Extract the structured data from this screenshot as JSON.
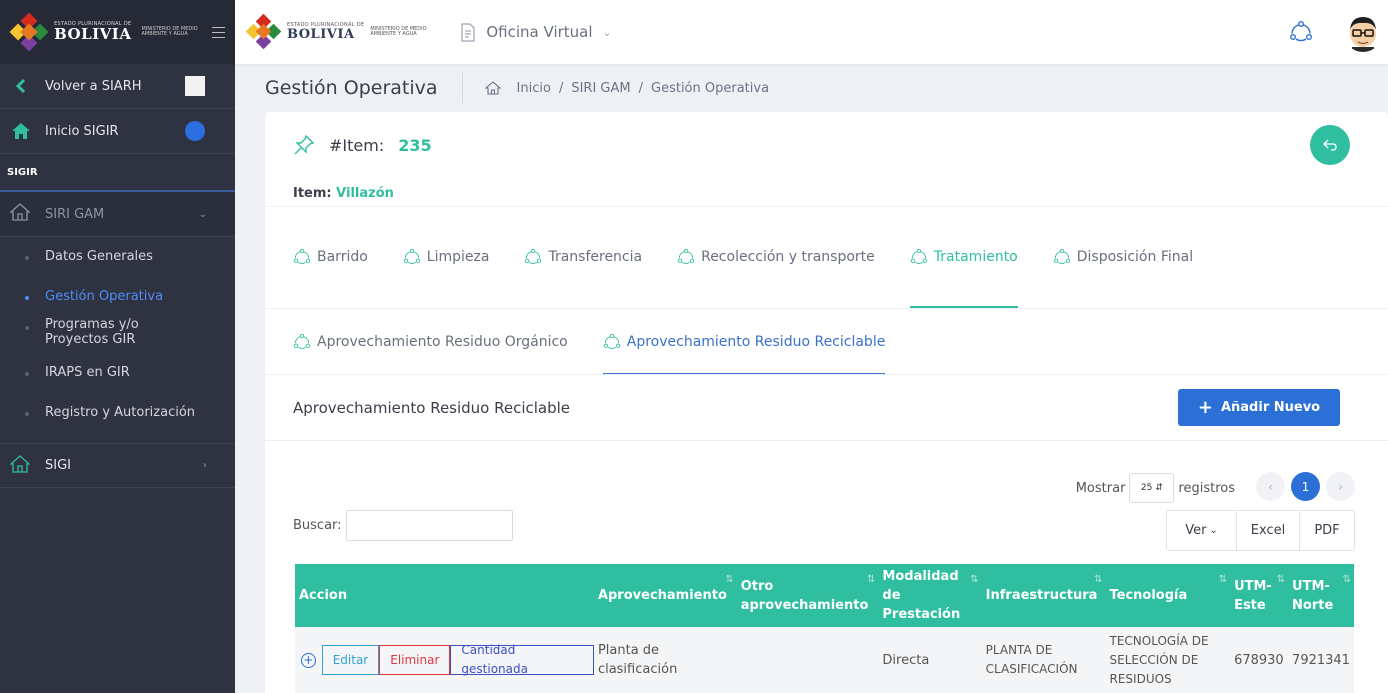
{
  "sidebar": {
    "brand": {
      "small": "ESTADO PLURINACIONAL DE",
      "big": "BOLIVIA",
      "sub": "MINISTERIO DE MEDIO AMBIENTE Y AGUA"
    },
    "back_label": "Volver a SIARH",
    "home_label": "Inicio SIGIR",
    "section_label": "SIGIR",
    "siri_label": "SIRI GAM",
    "sub_items": [
      "Datos Generales",
      "Gestión Operativa",
      "Programas y/o Proyectos GIR",
      "IRAPS en GIR",
      "Registro y Autorización"
    ],
    "sigi_label": "SIGI"
  },
  "topbar": {
    "brand": {
      "small": "ESTADO PLURINACIONAL DE",
      "big": "BOLIVIA",
      "sub": "MINISTERIO DE MEDIO AMBIENTE Y AGUA"
    },
    "oficina_label": "Oficina Virtual"
  },
  "page": {
    "title": "Gestión Operativa",
    "breadcrumb": [
      "Inicio",
      "SIRI GAM",
      "Gestión Operativa"
    ],
    "sep": "/"
  },
  "item": {
    "label": "#Item:",
    "number": "235",
    "name_label": "Item:",
    "name_value": "Villazón"
  },
  "tabs": [
    "Barrido",
    "Limpieza",
    "Transferencia",
    "Recolección y transporte",
    "Tratamiento",
    "Disposición Final"
  ],
  "subtabs": [
    "Aprovechamiento Residuo Orgánico",
    "Aprovechamiento Residuo Reciclable"
  ],
  "section": {
    "title": "Aprovechamiento Residuo Reciclable",
    "add_label": "Añadir Nuevo"
  },
  "controls": {
    "mostrar": "Mostrar",
    "page_size": "25",
    "registros": "registros",
    "current_page": "1",
    "buscar": "Buscar:",
    "ver": "Ver",
    "excel": "Excel",
    "pdf": "PDF"
  },
  "table": {
    "headers": [
      "Accion",
      "Aprovechamiento",
      "Otro aprovechamiento",
      "Modalidad de Prestación",
      "Infraestructura",
      "Tecnología",
      "UTM-Este",
      "UTM-Norte"
    ],
    "row": {
      "editar": "Editar",
      "eliminar": "Eliminar",
      "cantidad": "Cantidad gestionada",
      "aprovechamiento": "Planta de clasificación",
      "otro": "",
      "modalidad": "Directa",
      "infraestructura": "PLANTA DE CLASIFICACIÓN",
      "tecnologia": "TECNOLOGÍA DE SELECCIÓN DE RESIDUOS",
      "utm_este": "678930",
      "utm_norte": "7921341"
    }
  },
  "colors": {
    "accent": "#2fbfa0",
    "primary": "#2c6fd6",
    "sidebar": "#2f3240"
  }
}
